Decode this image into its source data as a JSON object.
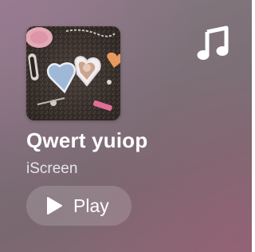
{
  "widget": {
    "artwork_icon": "album-artwork",
    "app_icon": "music-note-icon",
    "title": "Qwert yuiop",
    "artist": "iScreen",
    "play_label": "Play",
    "play_icon": "play-icon",
    "accent_color": "#ffffff"
  }
}
